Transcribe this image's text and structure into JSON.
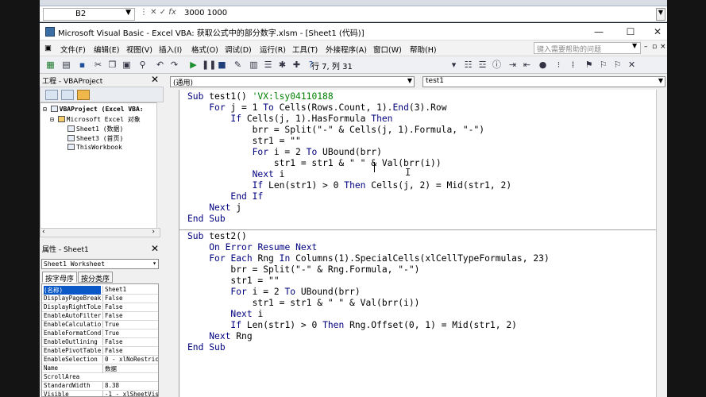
{
  "excel": {
    "name_box": "B2",
    "fx": "fx",
    "formula": "3000 1000"
  },
  "window": {
    "title": "Microsoft Visual Basic - Excel VBA: 获取公式中的部分数字.xlsm - [Sheet1 (代码)]",
    "minimize": "—",
    "maximize": "☐",
    "close": "✕"
  },
  "menu": {
    "items": [
      "文件(F)",
      "编辑(E)",
      "视图(V)",
      "插入(I)",
      "格式(O)",
      "调试(D)",
      "运行(R)",
      "工具(T)",
      "外接程序(A)",
      "窗口(W)",
      "帮助(H)"
    ],
    "help_placeholder": "键入需要帮助的问题"
  },
  "toolbar": {
    "cursor_position": "行 7, 列 31"
  },
  "project": {
    "title": "工程 - VBAProject",
    "tree": [
      "VBAProject (Excel VBA:",
      "Microsoft Excel 对象",
      "Sheet1 (数据)",
      "Sheet3 (首页)",
      "ThisWorkbook"
    ]
  },
  "properties": {
    "title": "属性 - Sheet1",
    "object": "Sheet1 Worksheet",
    "tabs": [
      "按字母序",
      "按分类序"
    ],
    "rows": [
      {
        "k": "(名称)",
        "v": "Sheet1"
      },
      {
        "k": "DisplayPageBreak",
        "v": "False"
      },
      {
        "k": "DisplayRightToLe",
        "v": "False"
      },
      {
        "k": "EnableAutoFilter",
        "v": "False"
      },
      {
        "k": "EnableCalculatio",
        "v": "True"
      },
      {
        "k": "EnableFormatCond",
        "v": "True"
      },
      {
        "k": "EnableOutlining",
        "v": "False"
      },
      {
        "k": "EnablePivotTable",
        "v": "False"
      },
      {
        "k": "EnableSelection",
        "v": "0 - xlNoRestric"
      },
      {
        "k": "Name",
        "v": "数据"
      },
      {
        "k": "ScrollArea",
        "v": ""
      },
      {
        "k": "StandardWidth",
        "v": "8.38"
      },
      {
        "k": "Visible",
        "v": "-1 - xlSheetVis"
      }
    ]
  },
  "code": {
    "object_combo": "(通用)",
    "proc_combo": "test1",
    "lines": [
      "Sub test1() 'VX:lsy04110188",
      "    For j = 1 To Cells(Rows.Count, 1).End(3).Row",
      "        If Cells(j, 1).HasFormula Then",
      "            brr = Split(\"-\" & Cells(j, 1).Formula, \"-\")",
      "            str1 = \"\"",
      "            For i = 2 To UBound(brr)",
      "                str1 = str1 & \" \" & Val(brr(i))",
      "            Next i",
      "            If Len(str1) > 0 Then Cells(j, 2) = Mid(str1, 2)",
      "        End If",
      "    Next j",
      "End Sub",
      "Sub test2()",
      "    On Error Resume Next",
      "    For Each Rng In Columns(1).SpecialCells(xlCellTypeFormulas, 23)",
      "        brr = Split(\"-\" & Rng.Formula, \"-\")",
      "        str1 = \"\"",
      "        For i = 2 To UBound(brr)",
      "            str1 = str1 & \" \" & Val(brr(i))",
      "        Next i",
      "        If Len(str1) > 0 Then Rng.Offset(0, 1) = Mid(str1, 2)",
      "    Next Rng",
      "End Sub"
    ]
  }
}
